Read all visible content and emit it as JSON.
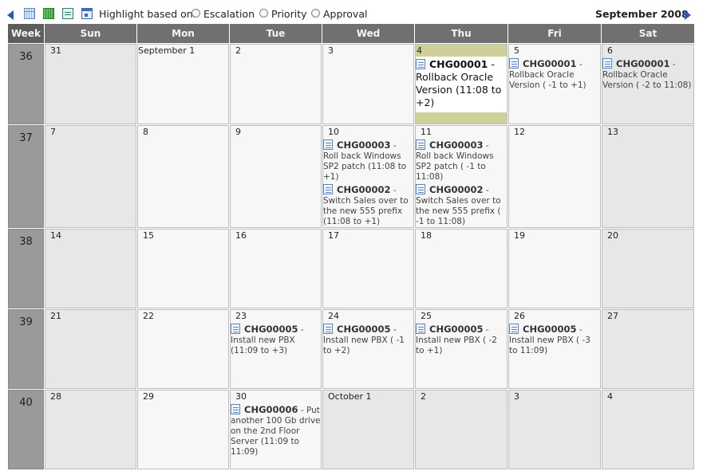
{
  "toolbar": {
    "highlight_label": "Highlight based on:",
    "options": [
      "Escalation",
      "Priority",
      "Approval"
    ],
    "month_title": "September 2008"
  },
  "headers": [
    "Week",
    "Sun",
    "Mon",
    "Tue",
    "Wed",
    "Thu",
    "Fri",
    "Sat"
  ],
  "weeks": [
    {
      "week": "36",
      "days": [
        {
          "label": "31",
          "weekend": true,
          "events": []
        },
        {
          "label": "September 1",
          "first": true,
          "events": []
        },
        {
          "label": "2",
          "events": []
        },
        {
          "label": "3",
          "events": []
        },
        {
          "label": "4",
          "today": true,
          "events": [
            {
              "id": "CHG00001",
              "text": " - Rollback Oracle Version (11:08 to +2)"
            }
          ]
        },
        {
          "label": "5",
          "events": [
            {
              "id": "CHG00001",
              "text": " - Rollback Oracle Version ( -1 to +1)"
            }
          ]
        },
        {
          "label": "6",
          "weekend": true,
          "events": [
            {
              "id": "CHG00001",
              "text": " - Rollback Oracle Version ( -2 to 11:08)"
            }
          ]
        }
      ]
    },
    {
      "week": "37",
      "days": [
        {
          "label": "7",
          "weekend": true,
          "events": []
        },
        {
          "label": "8",
          "events": []
        },
        {
          "label": "9",
          "events": []
        },
        {
          "label": "10",
          "events": [
            {
              "id": "CHG00003",
              "text": " - Roll back Windows SP2 patch (11:08 to +1)"
            },
            {
              "id": "CHG00002",
              "text": " - Switch Sales over to the new 555 prefix (11:08 to +1)"
            }
          ]
        },
        {
          "label": "11",
          "events": [
            {
              "id": "CHG00003",
              "text": " - Roll back Windows SP2 patch ( -1 to 11:08)"
            },
            {
              "id": "CHG00002",
              "text": " - Switch Sales over to the new 555 prefix ( -1 to 11:08)"
            }
          ]
        },
        {
          "label": "12",
          "events": []
        },
        {
          "label": "13",
          "weekend": true,
          "events": []
        }
      ]
    },
    {
      "week": "38",
      "days": [
        {
          "label": "14",
          "weekend": true,
          "events": []
        },
        {
          "label": "15",
          "events": []
        },
        {
          "label": "16",
          "events": []
        },
        {
          "label": "17",
          "events": []
        },
        {
          "label": "18",
          "events": []
        },
        {
          "label": "19",
          "events": []
        },
        {
          "label": "20",
          "weekend": true,
          "events": []
        }
      ]
    },
    {
      "week": "39",
      "days": [
        {
          "label": "21",
          "weekend": true,
          "events": []
        },
        {
          "label": "22",
          "events": []
        },
        {
          "label": "23",
          "events": [
            {
              "id": "CHG00005",
              "text": " - Install new PBX (11:09 to +3)"
            }
          ]
        },
        {
          "label": "24",
          "events": [
            {
              "id": "CHG00005",
              "text": " - Install new PBX ( -1 to +2)"
            }
          ]
        },
        {
          "label": "25",
          "events": [
            {
              "id": "CHG00005",
              "text": " - Install new PBX ( -2 to +1)"
            }
          ]
        },
        {
          "label": "26",
          "events": [
            {
              "id": "CHG00005",
              "text": " - Install new PBX ( -3 to 11:09)"
            }
          ]
        },
        {
          "label": "27",
          "weekend": true,
          "events": []
        }
      ]
    },
    {
      "week": "40",
      "days": [
        {
          "label": "28",
          "weekend": true,
          "events": []
        },
        {
          "label": "29",
          "events": []
        },
        {
          "label": "30",
          "events": [
            {
              "id": "CHG00006",
              "text": " - Put another 100 Gb drive on the 2nd Floor Server (11:09 to 11:09)"
            }
          ]
        },
        {
          "label": "October 1",
          "weekend": true,
          "events": []
        },
        {
          "label": "2",
          "weekend": true,
          "events": []
        },
        {
          "label": "3",
          "weekend": true,
          "events": []
        },
        {
          "label": "4",
          "weekend": true,
          "events": []
        }
      ]
    }
  ]
}
